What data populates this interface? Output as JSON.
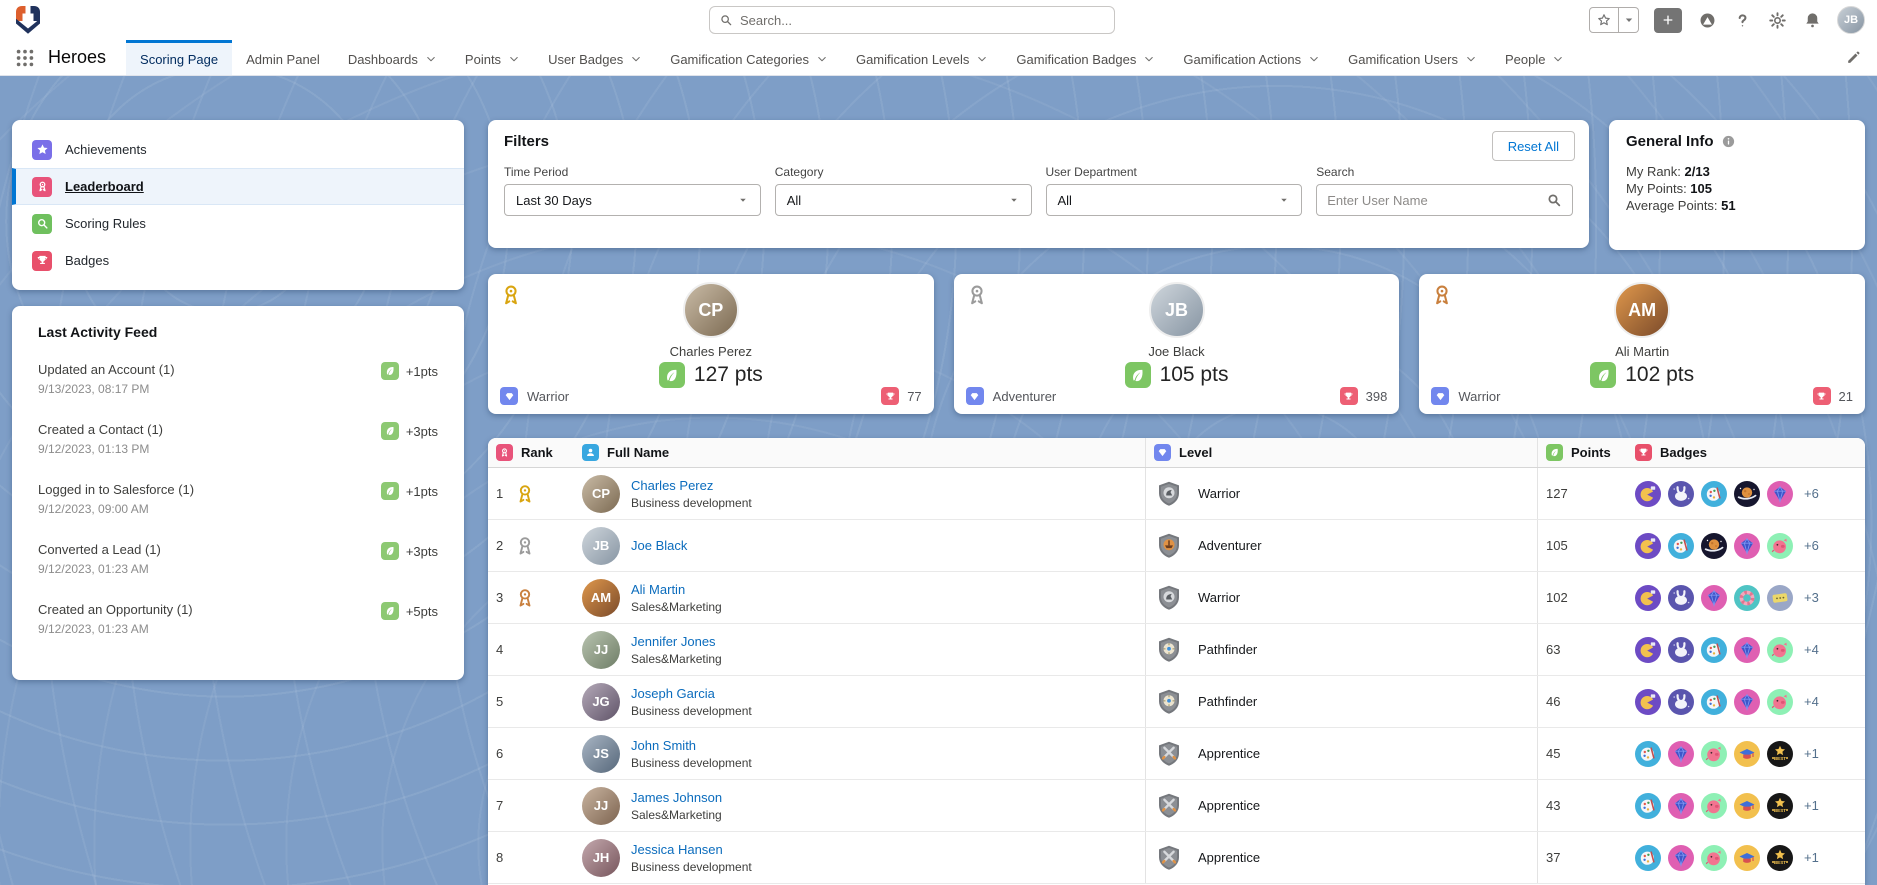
{
  "topbar": {
    "search_placeholder": "Search...",
    "user_initials": "JB"
  },
  "tabbar": {
    "app_name": "Heroes",
    "tabs": [
      {
        "label": "Scoring Page",
        "active": true,
        "has_menu": false
      },
      {
        "label": "Admin Panel",
        "active": false,
        "has_menu": false
      },
      {
        "label": "Dashboards",
        "active": false,
        "has_menu": true
      },
      {
        "label": "Points",
        "active": false,
        "has_menu": true
      },
      {
        "label": "User Badges",
        "active": false,
        "has_menu": true
      },
      {
        "label": "Gamification Categories",
        "active": false,
        "has_menu": true
      },
      {
        "label": "Gamification Levels",
        "active": false,
        "has_menu": true
      },
      {
        "label": "Gamification Badges",
        "active": false,
        "has_menu": true
      },
      {
        "label": "Gamification Actions",
        "active": false,
        "has_menu": true
      },
      {
        "label": "Gamification Users",
        "active": false,
        "has_menu": true
      },
      {
        "label": "People",
        "active": false,
        "has_menu": true
      }
    ]
  },
  "sidebar": {
    "items": [
      {
        "label": "Achievements",
        "icon": "star",
        "color": "#7a6fe8",
        "active": false
      },
      {
        "label": "Leaderboard",
        "icon": "medal-ribbon",
        "color": "#e8537a",
        "active": true
      },
      {
        "label": "Scoring Rules",
        "icon": "magnifier",
        "color": "#6fc05e",
        "active": false
      },
      {
        "label": "Badges",
        "icon": "trophy",
        "color": "#e8506b",
        "active": false
      }
    ]
  },
  "activity": {
    "title": "Last Activity Feed",
    "items": [
      {
        "label": "Updated an Account (1)",
        "date": "9/13/2023, 08:17 PM",
        "points": "+1pts"
      },
      {
        "label": "Created a Contact (1)",
        "date": "9/12/2023, 01:13 PM",
        "points": "+3pts"
      },
      {
        "label": "Logged in to Salesforce (1)",
        "date": "9/12/2023, 09:00 AM",
        "points": "+1pts"
      },
      {
        "label": "Converted a Lead (1)",
        "date": "9/12/2023, 01:23 AM",
        "points": "+3pts"
      },
      {
        "label": "Created an Opportunity (1)",
        "date": "9/12/2023, 01:23 AM",
        "points": "+5pts"
      }
    ]
  },
  "filters": {
    "title": "Filters",
    "reset_label": "Reset All",
    "fields": [
      {
        "label": "Time Period",
        "type": "select",
        "value": "Last 30 Days"
      },
      {
        "label": "Category",
        "type": "select",
        "value": "All"
      },
      {
        "label": "User Department",
        "type": "select",
        "value": "All"
      },
      {
        "label": "Search",
        "type": "search",
        "placeholder": "Enter User Name"
      }
    ]
  },
  "general_info": {
    "title": "General Info",
    "rows": [
      {
        "label": "My Rank: ",
        "value": "2/13"
      },
      {
        "label": "My Points: ",
        "value": "105"
      },
      {
        "label": "Average Points: ",
        "value": "51"
      }
    ]
  },
  "top_cards": [
    {
      "name": "Charles Perez",
      "initials": "CP",
      "avatar_class": "av-cp",
      "points": "127 pts",
      "level": "Warrior",
      "badge_count": "77",
      "medal": "gold"
    },
    {
      "name": "Joe Black",
      "initials": "JB",
      "avatar_class": "av-jb",
      "points": "105 pts",
      "level": "Adventurer",
      "badge_count": "398",
      "medal": "silver"
    },
    {
      "name": "Ali Martin",
      "initials": "AM",
      "avatar_class": "av-am",
      "points": "102 pts",
      "level": "Warrior",
      "badge_count": "21",
      "medal": "bronze"
    }
  ],
  "table": {
    "columns": [
      {
        "label": "Rank",
        "icon": "medal-ribbon",
        "color": "#e8537a"
      },
      {
        "label": "Full Name",
        "icon": "person",
        "color": "#38a7e0"
      },
      {
        "label": "Level",
        "icon": "gem",
        "color": "#7287ee"
      },
      {
        "label": "Points",
        "icon": "leaf",
        "color": "#7dc663"
      },
      {
        "label": "Badges",
        "icon": "trophy",
        "color": "#e8506b"
      }
    ],
    "rows": [
      {
        "rank": "1",
        "medal": "gold",
        "name": "Charles Perez",
        "department": "Business development",
        "initials": "CP",
        "avatar_class": "av-cp",
        "level": "Warrior",
        "points": "127",
        "badges": [
          "pacman",
          "rabbit",
          "palette",
          "space",
          "diamond"
        ],
        "more": "+6"
      },
      {
        "rank": "2",
        "medal": "silver",
        "name": "Joe Black",
        "department": "",
        "initials": "JB",
        "avatar_class": "av-jb",
        "level": "Adventurer",
        "points": "105",
        "badges": [
          "pacman",
          "palette",
          "space",
          "diamond",
          "piggy"
        ],
        "more": "+6"
      },
      {
        "rank": "3",
        "medal": "bronze",
        "name": "Ali Martin",
        "department": "Sales&Marketing",
        "initials": "AM",
        "avatar_class": "av-am",
        "level": "Warrior",
        "points": "102",
        "badges": [
          "pacman",
          "rabbit",
          "diamond",
          "donut",
          "ticket"
        ],
        "more": "+3"
      },
      {
        "rank": "4",
        "medal": "",
        "name": "Jennifer Jones",
        "department": "Sales&Marketing",
        "initials": "JJ",
        "avatar_class": "av-jj",
        "level": "Pathfinder",
        "points": "63",
        "badges": [
          "pacman",
          "rabbit",
          "palette",
          "diamond",
          "piggy"
        ],
        "more": "+4"
      },
      {
        "rank": "5",
        "medal": "",
        "name": "Joseph Garcia",
        "department": "Business development",
        "initials": "JG",
        "avatar_class": "av-jg",
        "level": "Pathfinder",
        "points": "46",
        "badges": [
          "pacman",
          "rabbit",
          "palette",
          "diamond",
          "piggy"
        ],
        "more": "+4"
      },
      {
        "rank": "6",
        "medal": "",
        "name": "John Smith",
        "department": "Business development",
        "initials": "JS",
        "avatar_class": "av-js",
        "level": "Apprentice",
        "points": "45",
        "badges": [
          "palette",
          "diamond",
          "piggy",
          "grad",
          "best"
        ],
        "more": "+1"
      },
      {
        "rank": "7",
        "medal": "",
        "name": "James Johnson",
        "department": "Sales&Marketing",
        "initials": "JJ",
        "avatar_class": "av-jj2",
        "level": "Apprentice",
        "points": "43",
        "badges": [
          "palette",
          "diamond",
          "piggy",
          "grad",
          "best"
        ],
        "more": "+1"
      },
      {
        "rank": "8",
        "medal": "",
        "name": "Jessica Hansen",
        "department": "Business development",
        "initials": "JH",
        "avatar_class": "av-jh",
        "level": "Apprentice",
        "points": "37",
        "badges": [
          "palette",
          "diamond",
          "piggy",
          "grad",
          "best"
        ],
        "more": "+1"
      }
    ]
  },
  "colors": {
    "accent": "#0176d3",
    "link": "#0b6cbd",
    "points_green": "#7dc663",
    "badge_red": "#ed5f74",
    "level_indigo": "#7287ee",
    "page_background": "#7e9ec7"
  }
}
